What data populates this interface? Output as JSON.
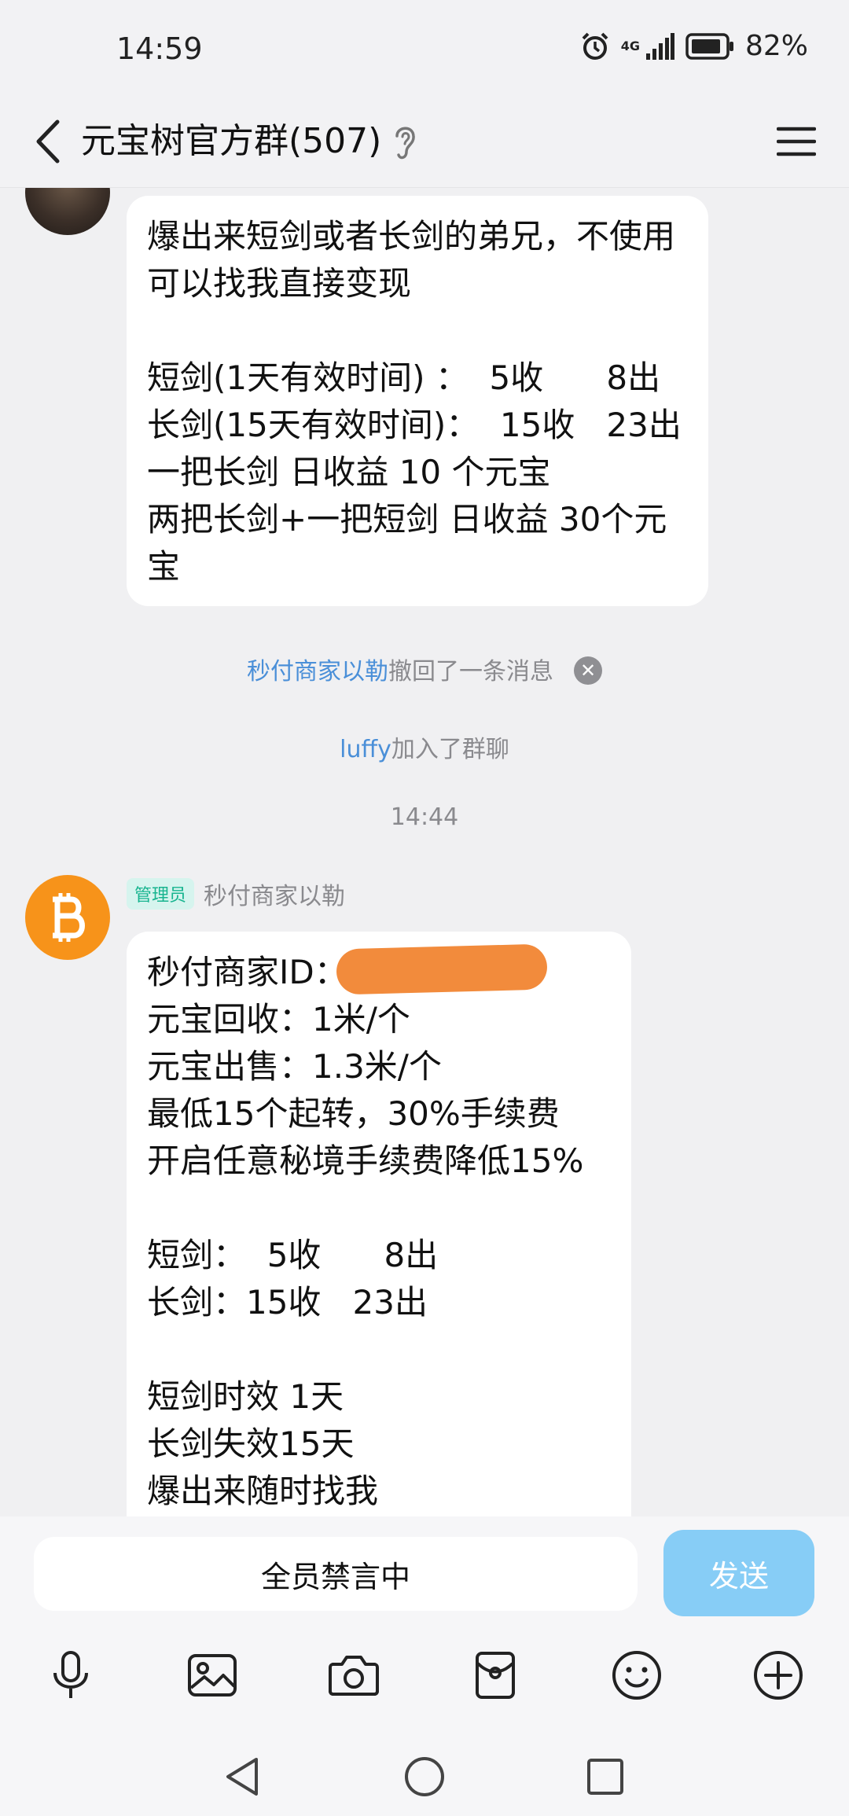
{
  "status_bar": {
    "time": "14:59",
    "network": "4G",
    "battery": "82%"
  },
  "header": {
    "title": "元宝树官方群(507)"
  },
  "messages": [
    {
      "text": "爆出来短剑或者长剑的弟兄，不使用可以找我直接变现\n\n短剑(1天有效时间) ：  5收      8出\n长剑(15天有效时间)：  15收   23出\n一把长剑 日收益 10 个元宝\n两把长剑+一把短剑 日收益 30个元宝"
    },
    {
      "badge": "管理员",
      "sender": "秒付商家以勒",
      "text": "秒付商家ID： Z\n元宝回收：1米/个\n元宝出售：1.3米/个\n最低15个起转，30%手续费\n开启任意秘境手续费降低15%\n\n短剑：  5收      8出\n长剑：15收   23出\n\n短剑时效 1天\n长剑失效15天\n爆出来随时找我"
    }
  ],
  "system": {
    "recall_name": "秒付商家以勒",
    "recall_text": "撤回了一条消息",
    "join_name": "luffy",
    "join_text": "加入了群聊",
    "time_sep": "14:44"
  },
  "input": {
    "mute_text": "全员禁言中",
    "send_label": "发送"
  },
  "icons": {
    "toolbar": [
      "microphone-icon",
      "image-icon",
      "camera-icon",
      "red-packet-icon",
      "emoji-icon",
      "plus-icon"
    ],
    "nav": [
      "back-triangle-icon",
      "home-circle-icon",
      "recents-square-icon"
    ]
  },
  "colors": {
    "accent": "#4a8fd8",
    "send_button": "#87cdf6",
    "admin_badge": "#17b48f",
    "btc_avatar": "#f7931a"
  }
}
